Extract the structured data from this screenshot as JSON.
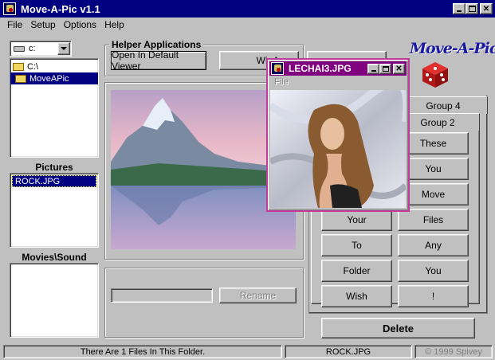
{
  "window": {
    "title": "Move-A-Pic  v1.1"
  },
  "menu": {
    "file": "File",
    "setup": "Setup",
    "options": "Options",
    "help": "Help"
  },
  "drive": {
    "selected": "c:"
  },
  "folders": [
    {
      "label": "C:\\",
      "selected": false
    },
    {
      "label": "MoveAPic",
      "selected": true
    }
  ],
  "pictures": {
    "heading": "Pictures",
    "files": [
      "ROCK.JPG"
    ]
  },
  "movies": {
    "heading": "Movies\\Sound"
  },
  "helper": {
    "heading": "Helper Applications",
    "open_default": "Open In Default Viewer",
    "second": "WinA"
  },
  "logo": {
    "text": "Move-A-Pic"
  },
  "rename": {
    "label": "Rename",
    "value": ""
  },
  "groups": {
    "tab_back": "Group 4",
    "tab_front": "Group 2"
  },
  "group_buttons": {
    "left": [
      "",
      "",
      "",
      "Your",
      "To",
      "Folder",
      "Wish"
    ],
    "right": [
      "These",
      "You",
      "Move",
      "Files",
      "Any",
      "You",
      "!"
    ]
  },
  "delete_label": "Delete",
  "status": {
    "files_count": "There Are 1 Files In This Folder.",
    "current_file": "ROCK.JPG",
    "copyright": "© 1999 Spivey"
  },
  "popup": {
    "title": "LECHAI3.JPG",
    "menu_file": "File"
  },
  "colors": {
    "title_active": "#000080",
    "popup_title": "#800080",
    "face": "#c0c0c0"
  }
}
